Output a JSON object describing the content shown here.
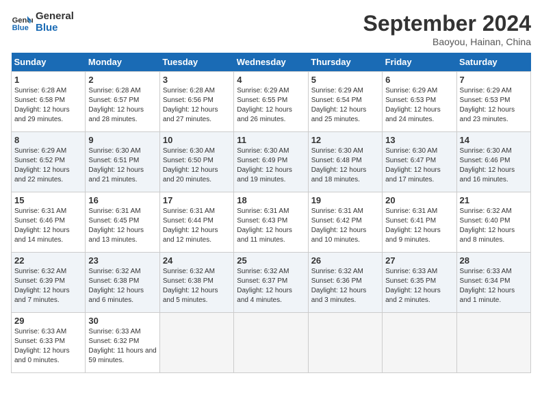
{
  "logo": {
    "line1": "General",
    "line2": "Blue"
  },
  "title": "September 2024",
  "subtitle": "Baoyou, Hainan, China",
  "days_header": [
    "Sunday",
    "Monday",
    "Tuesday",
    "Wednesday",
    "Thursday",
    "Friday",
    "Saturday"
  ],
  "weeks": [
    [
      {
        "day": "1",
        "sunrise": "6:28 AM",
        "sunset": "6:58 PM",
        "daylight": "12 hours and 29 minutes."
      },
      {
        "day": "2",
        "sunrise": "6:28 AM",
        "sunset": "6:57 PM",
        "daylight": "12 hours and 28 minutes."
      },
      {
        "day": "3",
        "sunrise": "6:28 AM",
        "sunset": "6:56 PM",
        "daylight": "12 hours and 27 minutes."
      },
      {
        "day": "4",
        "sunrise": "6:29 AM",
        "sunset": "6:55 PM",
        "daylight": "12 hours and 26 minutes."
      },
      {
        "day": "5",
        "sunrise": "6:29 AM",
        "sunset": "6:54 PM",
        "daylight": "12 hours and 25 minutes."
      },
      {
        "day": "6",
        "sunrise": "6:29 AM",
        "sunset": "6:53 PM",
        "daylight": "12 hours and 24 minutes."
      },
      {
        "day": "7",
        "sunrise": "6:29 AM",
        "sunset": "6:53 PM",
        "daylight": "12 hours and 23 minutes."
      }
    ],
    [
      {
        "day": "8",
        "sunrise": "6:29 AM",
        "sunset": "6:52 PM",
        "daylight": "12 hours and 22 minutes."
      },
      {
        "day": "9",
        "sunrise": "6:30 AM",
        "sunset": "6:51 PM",
        "daylight": "12 hours and 21 minutes."
      },
      {
        "day": "10",
        "sunrise": "6:30 AM",
        "sunset": "6:50 PM",
        "daylight": "12 hours and 20 minutes."
      },
      {
        "day": "11",
        "sunrise": "6:30 AM",
        "sunset": "6:49 PM",
        "daylight": "12 hours and 19 minutes."
      },
      {
        "day": "12",
        "sunrise": "6:30 AM",
        "sunset": "6:48 PM",
        "daylight": "12 hours and 18 minutes."
      },
      {
        "day": "13",
        "sunrise": "6:30 AM",
        "sunset": "6:47 PM",
        "daylight": "12 hours and 17 minutes."
      },
      {
        "day": "14",
        "sunrise": "6:30 AM",
        "sunset": "6:46 PM",
        "daylight": "12 hours and 16 minutes."
      }
    ],
    [
      {
        "day": "15",
        "sunrise": "6:31 AM",
        "sunset": "6:46 PM",
        "daylight": "12 hours and 14 minutes."
      },
      {
        "day": "16",
        "sunrise": "6:31 AM",
        "sunset": "6:45 PM",
        "daylight": "12 hours and 13 minutes."
      },
      {
        "day": "17",
        "sunrise": "6:31 AM",
        "sunset": "6:44 PM",
        "daylight": "12 hours and 12 minutes."
      },
      {
        "day": "18",
        "sunrise": "6:31 AM",
        "sunset": "6:43 PM",
        "daylight": "12 hours and 11 minutes."
      },
      {
        "day": "19",
        "sunrise": "6:31 AM",
        "sunset": "6:42 PM",
        "daylight": "12 hours and 10 minutes."
      },
      {
        "day": "20",
        "sunrise": "6:31 AM",
        "sunset": "6:41 PM",
        "daylight": "12 hours and 9 minutes."
      },
      {
        "day": "21",
        "sunrise": "6:32 AM",
        "sunset": "6:40 PM",
        "daylight": "12 hours and 8 minutes."
      }
    ],
    [
      {
        "day": "22",
        "sunrise": "6:32 AM",
        "sunset": "6:39 PM",
        "daylight": "12 hours and 7 minutes."
      },
      {
        "day": "23",
        "sunrise": "6:32 AM",
        "sunset": "6:38 PM",
        "daylight": "12 hours and 6 minutes."
      },
      {
        "day": "24",
        "sunrise": "6:32 AM",
        "sunset": "6:38 PM",
        "daylight": "12 hours and 5 minutes."
      },
      {
        "day": "25",
        "sunrise": "6:32 AM",
        "sunset": "6:37 PM",
        "daylight": "12 hours and 4 minutes."
      },
      {
        "day": "26",
        "sunrise": "6:32 AM",
        "sunset": "6:36 PM",
        "daylight": "12 hours and 3 minutes."
      },
      {
        "day": "27",
        "sunrise": "6:33 AM",
        "sunset": "6:35 PM",
        "daylight": "12 hours and 2 minutes."
      },
      {
        "day": "28",
        "sunrise": "6:33 AM",
        "sunset": "6:34 PM",
        "daylight": "12 hours and 1 minute."
      }
    ],
    [
      {
        "day": "29",
        "sunrise": "6:33 AM",
        "sunset": "6:33 PM",
        "daylight": "12 hours and 0 minutes."
      },
      {
        "day": "30",
        "sunrise": "6:33 AM",
        "sunset": "6:32 PM",
        "daylight": "11 hours and 59 minutes."
      },
      null,
      null,
      null,
      null,
      null
    ]
  ]
}
